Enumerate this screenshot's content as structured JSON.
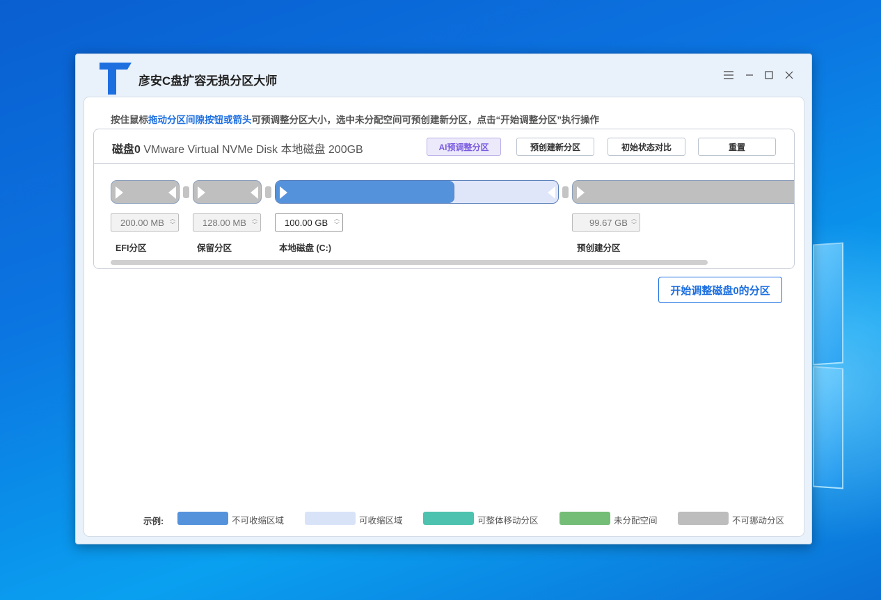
{
  "app": {
    "title": "彦安C盘扩容无损分区大师"
  },
  "hint": {
    "part1": "按住鼠标",
    "part2": "拖动分区间隙按钮或箭头",
    "part3": "可预调整分区大小，选中未分配空间可预创建新分区，点击“开始调整分区”执行操作"
  },
  "disk": {
    "name": "磁盘0",
    "desc": "VMware Virtual NVMe Disk 本地磁盘 200GB",
    "buttons": {
      "ai": "AI预调整分区",
      "precreate": "预创建新分区",
      "compare": "初始状态对比",
      "reset": "重置"
    }
  },
  "partitions": [
    {
      "label": "EFI分区",
      "size": "200.00 MB",
      "editable": false
    },
    {
      "label": "保留分区",
      "size": "128.00 MB",
      "editable": false
    },
    {
      "label": "本地磁盘 (C:)",
      "size": "100.00 GB",
      "editable": true,
      "used_fraction": 0.63
    },
    {
      "label": "预创建分区",
      "size": "99.67 GB",
      "editable": false
    }
  ],
  "start_button": "开始调整磁盘0的分区",
  "legend": {
    "title": "示例:",
    "items": [
      {
        "label": "不可收缩区域",
        "color": "#5592dc"
      },
      {
        "label": "可收缩区域",
        "color": "#d9e3f8"
      },
      {
        "label": "可整体移动分区",
        "color": "#4dc2ae"
      },
      {
        "label": "未分配空间",
        "color": "#74bd77"
      },
      {
        "label": "不可挪动分区",
        "color": "#bdbdbd"
      }
    ]
  }
}
